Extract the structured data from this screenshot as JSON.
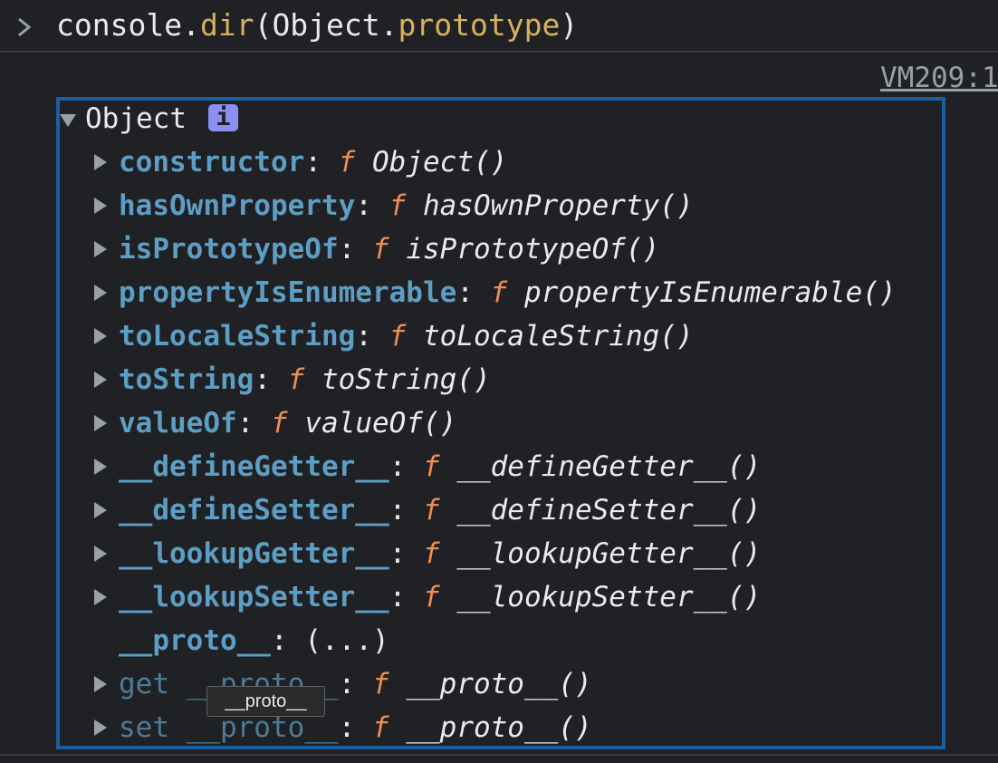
{
  "input": {
    "object": "console",
    "dot1": ".",
    "method": "dir",
    "open_paren": "(",
    "arg_object": "Object",
    "dot2": ".",
    "arg_prop": "prototype",
    "close_paren": ")"
  },
  "source_link": "VM209:1",
  "root": {
    "label": "Object",
    "info_badge": "i"
  },
  "properties": [
    {
      "key": "constructor",
      "colon": ":",
      "fsym": "f",
      "fname": "Object()"
    },
    {
      "key": "hasOwnProperty",
      "colon": ":",
      "fsym": "f",
      "fname": "hasOwnProperty()"
    },
    {
      "key": "isPrototypeOf",
      "colon": ":",
      "fsym": "f",
      "fname": "isPrototypeOf()"
    },
    {
      "key": "propertyIsEnumerable",
      "colon": ":",
      "fsym": "f",
      "fname": "propertyIsEnumerable()"
    },
    {
      "key": "toLocaleString",
      "colon": ":",
      "fsym": "f",
      "fname": "toLocaleString()"
    },
    {
      "key": "toString",
      "colon": ":",
      "fsym": "f",
      "fname": "toString()"
    },
    {
      "key": "valueOf",
      "colon": ":",
      "fsym": "f",
      "fname": "valueOf()"
    },
    {
      "key": "__defineGetter__",
      "colon": ":",
      "fsym": "f",
      "fname": "__defineGetter__()"
    },
    {
      "key": "__defineSetter__",
      "colon": ":",
      "fsym": "f",
      "fname": "__defineSetter__()"
    },
    {
      "key": "__lookupGetter__",
      "colon": ":",
      "fsym": "f",
      "fname": "__lookupGetter__()"
    },
    {
      "key": "__lookupSetter__",
      "colon": ":",
      "fsym": "f",
      "fname": "__lookupSetter__()"
    }
  ],
  "proto_row": {
    "key": "__proto__",
    "colon": ":",
    "value": "(...)"
  },
  "accessor_rows": [
    {
      "key": "get __proto__",
      "colon": ":",
      "fsym": "f",
      "fname": "__proto__()"
    },
    {
      "key": "set __proto__",
      "colon": ":",
      "fsym": "f",
      "fname": "__proto__()"
    }
  ],
  "tooltip": "__proto__",
  "colors": {
    "background": "#202124",
    "key": "#5d9ec4",
    "function_symbol": "#f28b54",
    "method_highlight": "#d9b15c",
    "highlight_border": "#1a5fa0",
    "info_badge": "#8a8ff0"
  },
  "icons": {
    "prompt": "chevron-right-icon",
    "root_toggle": "triangle-down-icon",
    "row_toggle": "triangle-right-icon"
  }
}
